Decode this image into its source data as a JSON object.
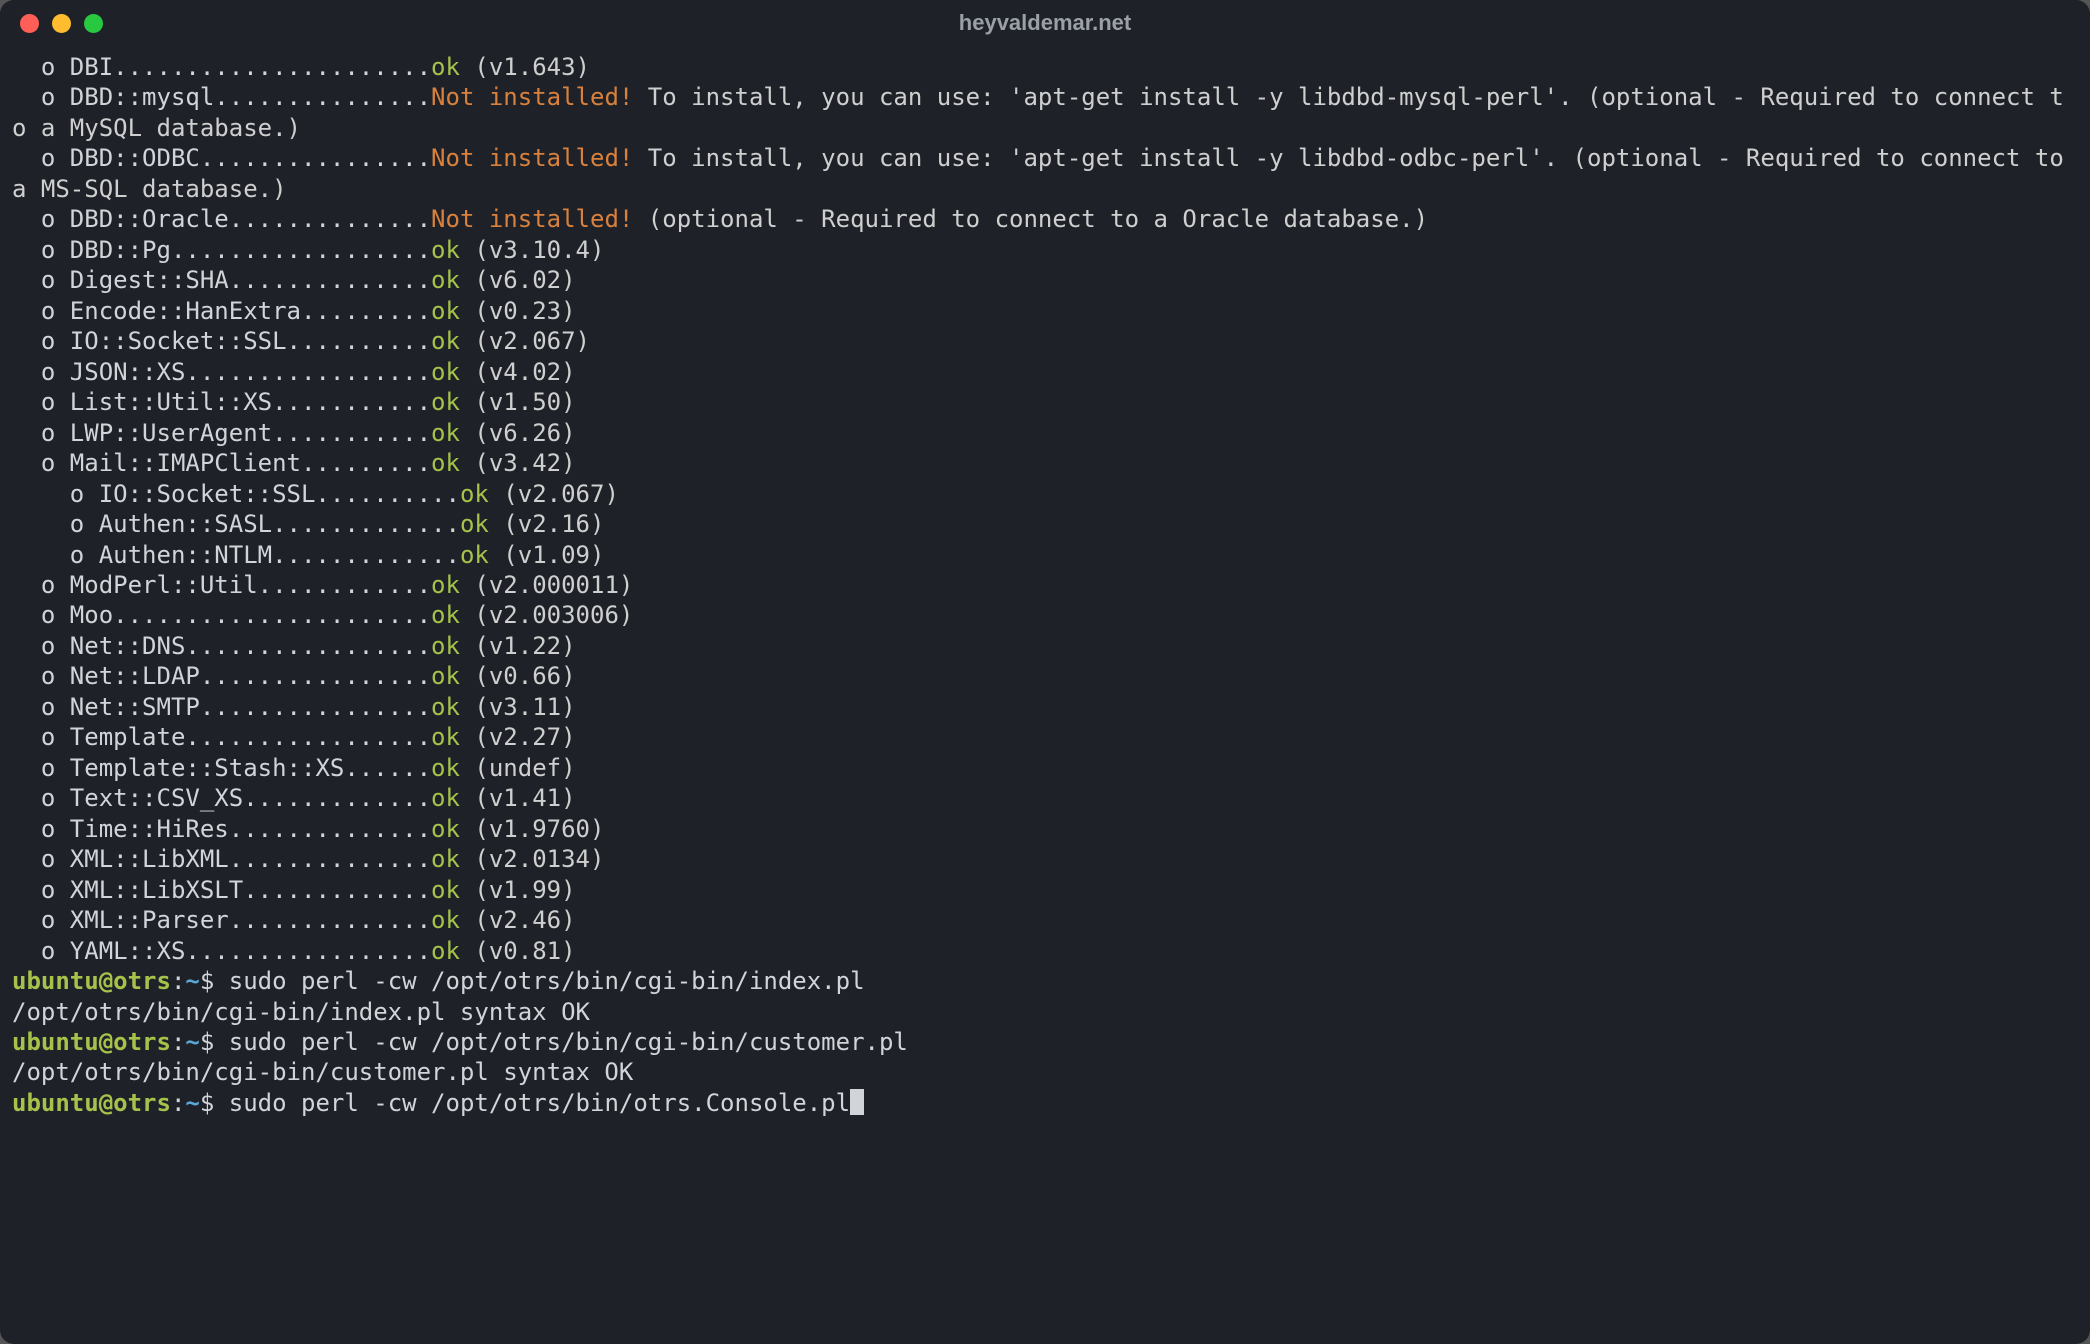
{
  "window": {
    "title": "heyvaldemar.net"
  },
  "colors": {
    "bg": "#1e2228",
    "text": "#d1d4d8",
    "ok": "#a6c24a",
    "warn": "#d9813c",
    "promptUser": "#a6c24a",
    "promptPath": "#5aa7d6"
  },
  "modules": [
    {
      "indent": 0,
      "name": "DBI",
      "status": "ok",
      "extra": "(v1.643)"
    },
    {
      "indent": 0,
      "name": "DBD::mysql",
      "status": "bad",
      "extra": "To install, you can use: 'apt-get install -y libdbd-mysql-perl'. (optional - Required to connect to a MySQL database.)"
    },
    {
      "indent": 0,
      "name": "DBD::ODBC",
      "status": "bad",
      "extra": "To install, you can use: 'apt-get install -y libdbd-odbc-perl'. (optional - Required to connect to a MS-SQL database.)"
    },
    {
      "indent": 0,
      "name": "DBD::Oracle",
      "status": "bad",
      "extra": "(optional - Required to connect to a Oracle database.)"
    },
    {
      "indent": 0,
      "name": "DBD::Pg",
      "status": "ok",
      "extra": "(v3.10.4)"
    },
    {
      "indent": 0,
      "name": "Digest::SHA",
      "status": "ok",
      "extra": "(v6.02)"
    },
    {
      "indent": 0,
      "name": "Encode::HanExtra",
      "status": "ok",
      "extra": "(v0.23)"
    },
    {
      "indent": 0,
      "name": "IO::Socket::SSL",
      "status": "ok",
      "extra": "(v2.067)"
    },
    {
      "indent": 0,
      "name": "JSON::XS",
      "status": "ok",
      "extra": "(v4.02)"
    },
    {
      "indent": 0,
      "name": "List::Util::XS",
      "status": "ok",
      "extra": "(v1.50)"
    },
    {
      "indent": 0,
      "name": "LWP::UserAgent",
      "status": "ok",
      "extra": "(v6.26)"
    },
    {
      "indent": 0,
      "name": "Mail::IMAPClient",
      "status": "ok",
      "extra": "(v3.42)"
    },
    {
      "indent": 1,
      "name": "IO::Socket::SSL",
      "status": "ok",
      "extra": "(v2.067)"
    },
    {
      "indent": 1,
      "name": "Authen::SASL",
      "status": "ok",
      "extra": "(v2.16)"
    },
    {
      "indent": 1,
      "name": "Authen::NTLM",
      "status": "ok",
      "extra": "(v1.09)"
    },
    {
      "indent": 0,
      "name": "ModPerl::Util",
      "status": "ok",
      "extra": "(v2.000011)"
    },
    {
      "indent": 0,
      "name": "Moo",
      "status": "ok",
      "extra": "(v2.003006)"
    },
    {
      "indent": 0,
      "name": "Net::DNS",
      "status": "ok",
      "extra": "(v1.22)"
    },
    {
      "indent": 0,
      "name": "Net::LDAP",
      "status": "ok",
      "extra": "(v0.66)"
    },
    {
      "indent": 0,
      "name": "Net::SMTP",
      "status": "ok",
      "extra": "(v3.11)"
    },
    {
      "indent": 0,
      "name": "Template",
      "status": "ok",
      "extra": "(v2.27)"
    },
    {
      "indent": 0,
      "name": "Template::Stash::XS",
      "status": "ok",
      "extra": "(undef)"
    },
    {
      "indent": 0,
      "name": "Text::CSV_XS",
      "status": "ok",
      "extra": "(v1.41)"
    },
    {
      "indent": 0,
      "name": "Time::HiRes",
      "status": "ok",
      "extra": "(v1.9760)"
    },
    {
      "indent": 0,
      "name": "XML::LibXML",
      "status": "ok",
      "extra": "(v2.0134)"
    },
    {
      "indent": 0,
      "name": "XML::LibXSLT",
      "status": "ok",
      "extra": "(v1.99)"
    },
    {
      "indent": 0,
      "name": "XML::Parser",
      "status": "ok",
      "extra": "(v2.46)"
    },
    {
      "indent": 0,
      "name": "YAML::XS",
      "status": "ok",
      "extra": "(v0.81)"
    }
  ],
  "status_labels": {
    "ok": "ok",
    "bad": "Not installed!"
  },
  "dot_column": 29,
  "prompt": {
    "user": "ubuntu",
    "at": "@",
    "host": "otrs",
    "colon": ":",
    "path": "~",
    "sigil": "$"
  },
  "history": [
    {
      "cmd": "sudo perl -cw /opt/otrs/bin/cgi-bin/index.pl",
      "out": "/opt/otrs/bin/cgi-bin/index.pl syntax OK"
    },
    {
      "cmd": "sudo perl -cw /opt/otrs/bin/cgi-bin/customer.pl",
      "out": "/opt/otrs/bin/cgi-bin/customer.pl syntax OK"
    }
  ],
  "current_cmd": "sudo perl -cw /opt/otrs/bin/otrs.Console.pl"
}
